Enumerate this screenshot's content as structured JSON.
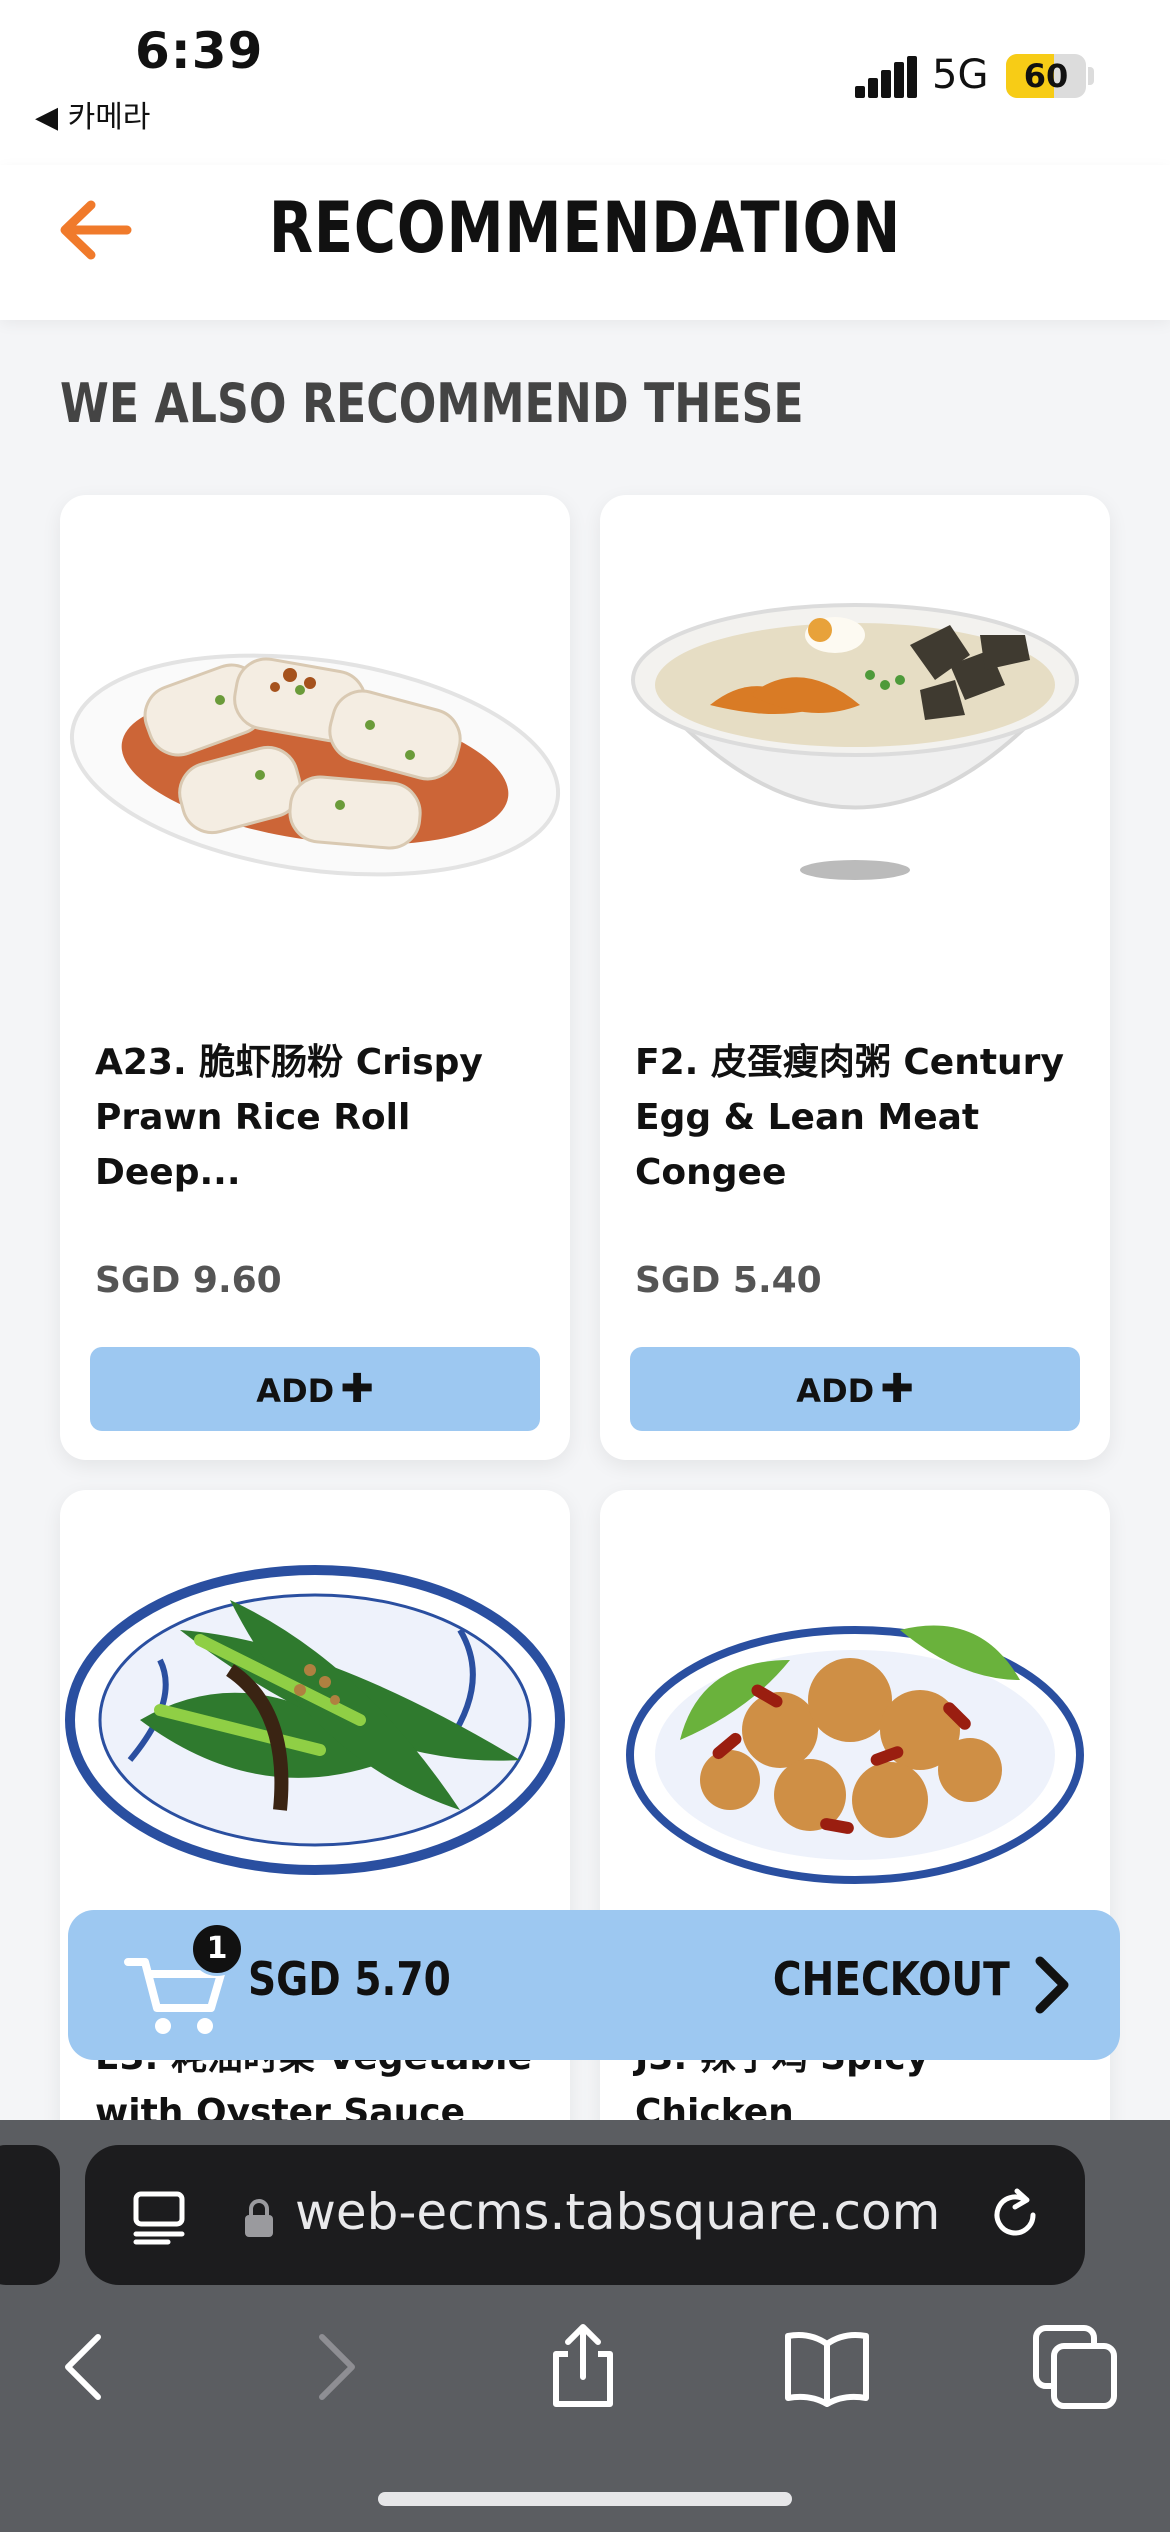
{
  "status_bar": {
    "time": "6:39",
    "back_app": "◀ 카메라",
    "network": "5G",
    "battery": "60",
    "battery_level": 0.6
  },
  "header": {
    "title": "RECOMMENDATION"
  },
  "section_title": "WE ALSO RECOMMEND THESE",
  "products": [
    {
      "name": "A23. 脆虾肠粉 Crispy Prawn Rice Roll Deep...",
      "price": "SGD 9.60",
      "add_label": "ADD"
    },
    {
      "name": "F2. 皮蛋瘦肉粥 Century Egg & Lean Meat Congee",
      "price": "SGD 5.40",
      "add_label": "ADD"
    },
    {
      "name": "E3. 耗油时菜 Vegetable with Oyster Sauce",
      "price": "",
      "add_label": ""
    },
    {
      "name": "J3. 辣子鸡 Spicy Chicken",
      "price": "",
      "add_label": ""
    }
  ],
  "cart": {
    "count": "1",
    "total": "SGD 5.70",
    "checkout_label": "CHECKOUT"
  },
  "browser": {
    "url": "web-ecms.tabsquare.com"
  },
  "colors": {
    "accent": "#f07a2b",
    "button": "#9dc8f1",
    "battery": "#f7cc16"
  },
  "icons": [
    "back-arrow-icon",
    "plus-icon",
    "cart-icon",
    "chevron-right-icon",
    "reader-icon",
    "lock-icon",
    "reload-icon",
    "back-icon",
    "forward-icon",
    "share-icon",
    "bookmarks-icon",
    "tabs-icon"
  ]
}
